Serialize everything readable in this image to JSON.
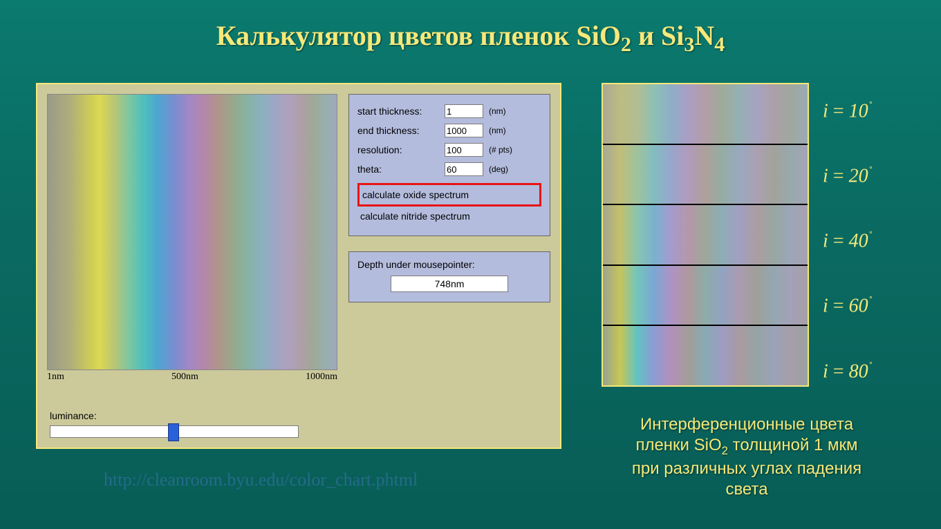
{
  "title": {
    "pre": "Калькулятор цветов пленок SiO",
    "sub1": "2",
    "mid": "  и Si",
    "sub2": "3",
    "post1": "N",
    "sub3": "4"
  },
  "form": {
    "start_label": "start thickness:",
    "start_value": "1",
    "start_unit": "(nm)",
    "end_label": "end thickness:",
    "end_value": "1000",
    "end_unit": "(nm)",
    "res_label": "resolution:",
    "res_value": "100",
    "res_unit": "(# pts)",
    "theta_label": "theta:",
    "theta_value": "60",
    "theta_unit": "(deg)",
    "btn_oxide": "calculate oxide spectrum",
    "btn_nitride": "calculate nitride spectrum"
  },
  "depth": {
    "label": "Depth under mousepointer:",
    "value": "748nm"
  },
  "luminance_label": "luminance:",
  "axis": {
    "t0": "1nm",
    "t1": "500nm",
    "t2": "1000nm"
  },
  "link": "http://cleanroom.byu.edu/color_chart.phtml",
  "angles": {
    "a1": "10",
    "a2": "20",
    "a3": "40",
    "a4": "60",
    "a5": "80"
  },
  "caption": {
    "l1": "Интерференционные цвета",
    "l2a": "пленки SiO",
    "l2sub": "2",
    "l2b": " толщиной 1 мкм",
    "l3": "при различных углах падения",
    "l4": "света"
  }
}
